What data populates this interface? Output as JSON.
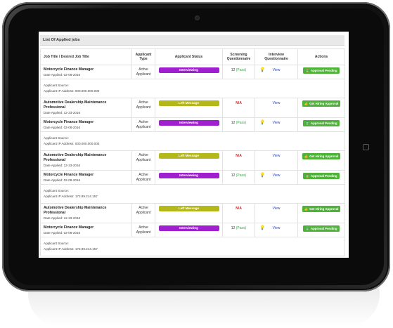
{
  "panel": {
    "title": "List Of Applied jobs"
  },
  "columns": {
    "job": "Job Title / Desired Job Title",
    "type": "Applicant Type",
    "status": "Applicant Status",
    "screening": "Screening Questionnaire",
    "interview": "Interview Questionnaire",
    "actions": "Actions"
  },
  "rows": [
    {
      "title": "Motorcycle Finance Manager",
      "date": "Date Applied: 02-08-2016",
      "type": "Active Applicant",
      "status": "Interviewing",
      "status_color": "#a020d0",
      "screening": "12",
      "pass": "(Pass)",
      "na": "",
      "view": "View",
      "action": "Approval Pending"
    },
    {
      "title": "Automotive Dealership Maintenance Professional",
      "date": "Date Applied: 12-23-2016",
      "type": "Active Applicant",
      "status": "Left Message",
      "status_color": "#b5b81a",
      "screening": "",
      "pass": "",
      "na": "N/A",
      "view": "View",
      "action": "Get Hiring Approval"
    },
    {
      "title": "Motorcycle Finance Manager",
      "date": "Date Applied: 02-08-2016",
      "type": "Active Applicant",
      "status": "Interviewing",
      "status_color": "#a020d0",
      "screening": "12",
      "pass": "(Pass)",
      "na": "",
      "view": "View",
      "action": "Approval Pending"
    },
    {
      "title": "Automotive Dealership Maintenance Professional",
      "date": "Date Applied: 12-23-2016",
      "type": "Active Applicant",
      "status": "Left Message",
      "status_color": "#b5b81a",
      "screening": "",
      "pass": "",
      "na": "N/A",
      "view": "View",
      "action": "Get Hiring Approval"
    },
    {
      "title": "Motorcycle Finance Manager",
      "date": "Date Applied: 02-08-2016",
      "type": "Active Applicant",
      "status": "Interviewing",
      "status_color": "#a020d0",
      "screening": "12",
      "pass": "(Pass)",
      "na": "",
      "view": "View",
      "action": "Approval Pending"
    },
    {
      "title": "Automotive Dealership Maintenance Professional",
      "date": "Date Applied: 12-23-2016",
      "type": "Active Applicant",
      "status": "Left Message",
      "status_color": "#b5b81a",
      "screening": "",
      "pass": "",
      "na": "N/A",
      "view": "View",
      "action": "Get Hiring Approval"
    },
    {
      "title": "Motorcycle Finance Manager",
      "date": "Date Applied: 02-08-2016",
      "type": "Active Applicant",
      "status": "Interviewing",
      "status_color": "#a020d0",
      "screening": "12",
      "pass": "(Pass)",
      "na": "",
      "view": "View",
      "action": "Approval Pending"
    }
  ],
  "sources": [
    {
      "label": "Applicant Source:",
      "ip": "Applicant IP Address: 000.000.000.000"
    },
    {
      "label": "Applicant Source:",
      "ip": "Applicant IP Address: 000.000.000.000"
    },
    {
      "label": "Applicant Source:",
      "ip": "Applicant IP Address: 172.89.214.157"
    },
    {
      "label": "Applicant Source:",
      "ip": "Applicant IP Address: 172.89.214.157"
    }
  ],
  "icons": {
    "bulb": "lightbulb-icon",
    "hourglass": "hourglass-icon",
    "thumbs_up": "thumbs-up-icon"
  },
  "colors": {
    "action_green": "#4fb33a",
    "interviewing": "#a020d0",
    "left_message": "#b5b81a",
    "view_link": "#1f3fbf",
    "pass": "#3aa54a",
    "na": "#e02020"
  }
}
